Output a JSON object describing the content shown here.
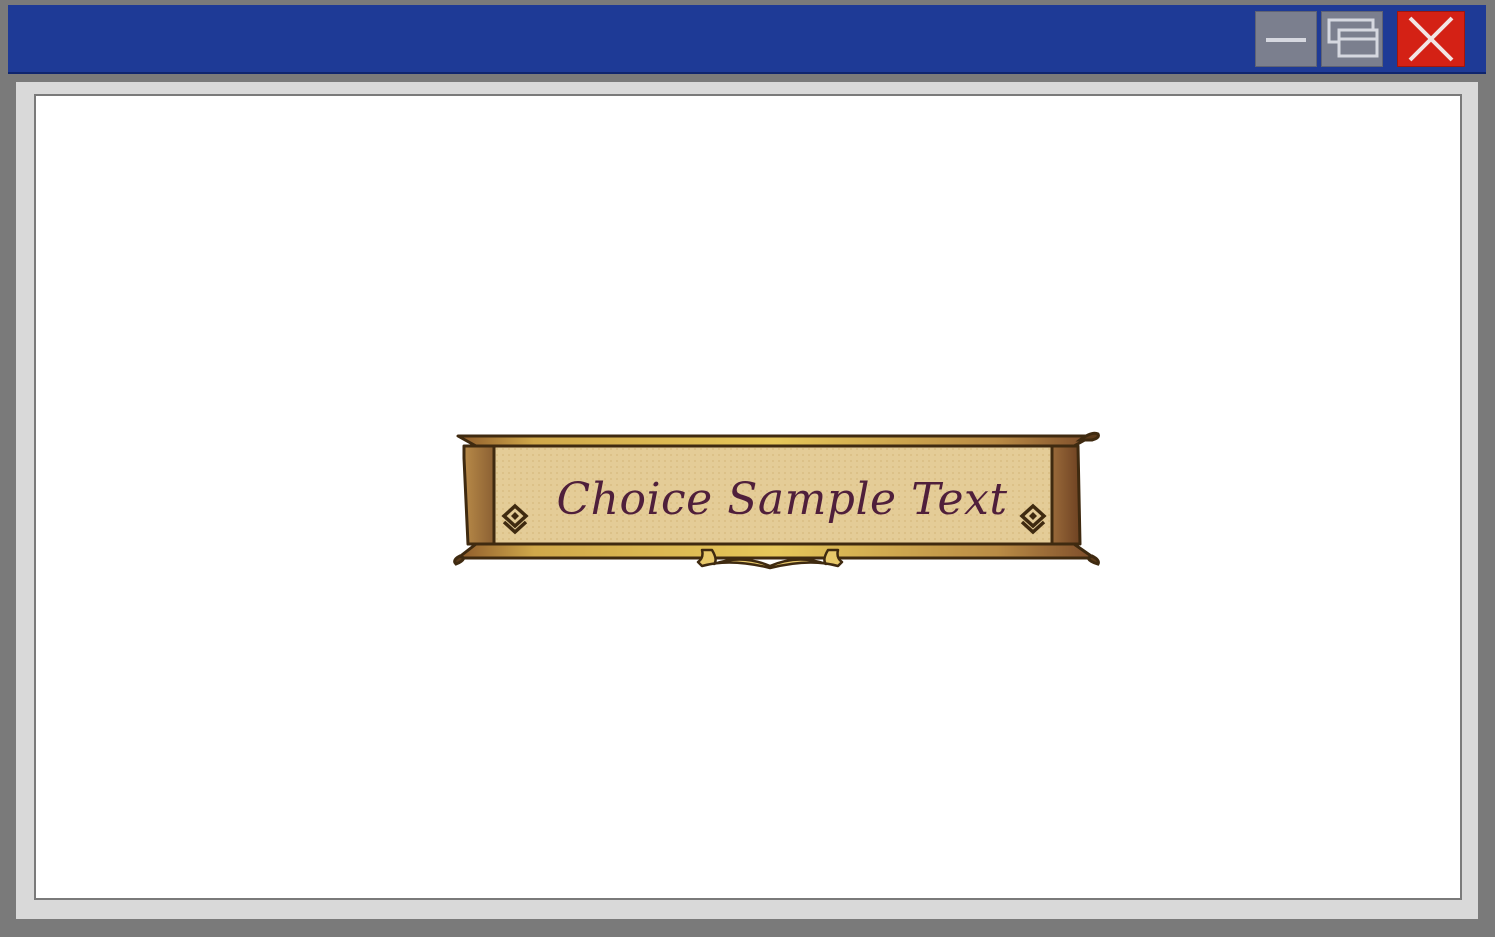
{
  "window": {
    "title": "",
    "colors": {
      "title_bar": "#1e3a96",
      "frame": "#7a7a7a",
      "close_button": "#d42115",
      "control_button": "#7b7f8e"
    },
    "controls": {
      "minimize_icon": "minimize-icon",
      "maximize_icon": "restore-icon",
      "close_icon": "close-icon"
    }
  },
  "scene": {
    "choice": {
      "label": "Choice Sample Text",
      "colors": {
        "text": "#4f1f3b",
        "panel": "#e4cc97",
        "frame_gold": "#c9a13b",
        "frame_brown": "#8a5a2e",
        "outline": "#3f2a10"
      },
      "ornament_icon": "diamond-ornament-icon"
    }
  }
}
